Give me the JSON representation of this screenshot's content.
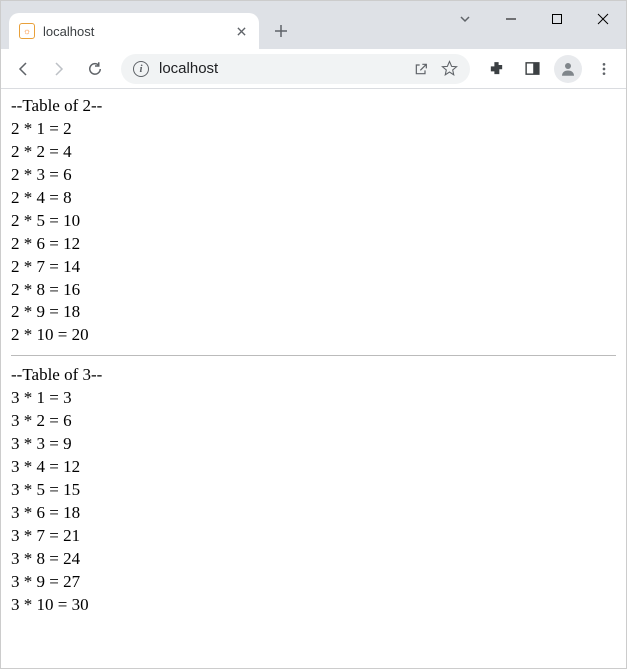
{
  "window": {
    "tab_title": "localhost",
    "favicon_letter": "☼",
    "url": "localhost"
  },
  "page": {
    "tables": [
      {
        "header": "--Table of 2--",
        "rows": [
          "2 * 1 = 2",
          "2 * 2 = 4",
          "2 * 3 = 6",
          "2 * 4 = 8",
          "2 * 5 = 10",
          "2 * 6 = 12",
          "2 * 7 = 14",
          "2 * 8 = 16",
          "2 * 9 = 18",
          "2 * 10 = 20"
        ]
      },
      {
        "header": "--Table of 3--",
        "rows": [
          "3 * 1 = 3",
          "3 * 2 = 6",
          "3 * 3 = 9",
          "3 * 4 = 12",
          "3 * 5 = 15",
          "3 * 6 = 18",
          "3 * 7 = 21",
          "3 * 8 = 24",
          "3 * 9 = 27",
          "3 * 10 = 30"
        ]
      }
    ]
  }
}
